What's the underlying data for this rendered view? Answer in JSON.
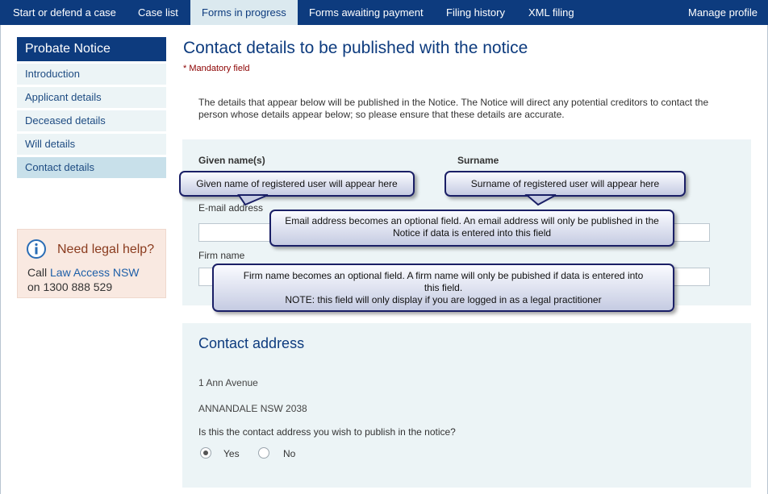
{
  "nav": {
    "items": [
      {
        "label": "Start or defend a case"
      },
      {
        "label": "Case list"
      },
      {
        "label": "Forms in progress",
        "active": true
      },
      {
        "label": "Forms awaiting payment"
      },
      {
        "label": "Filing history"
      },
      {
        "label": "XML filing"
      }
    ],
    "manage_profile": "Manage profile",
    "bar_color": "#0d3b7e"
  },
  "sidebar": {
    "heading": "Probate Notice",
    "items": [
      {
        "label": "Introduction"
      },
      {
        "label": "Applicant details"
      },
      {
        "label": "Deceased details"
      },
      {
        "label": "Will details"
      },
      {
        "label": "Contact details",
        "active": true
      }
    ]
  },
  "help": {
    "icon": "info-icon",
    "title": "Need legal help?",
    "call": "Call",
    "link": "Law Access NSW",
    "phone": "on 1300 888 529"
  },
  "main": {
    "title": "Contact details to be published with the notice",
    "mandatory": "* Mandatory field",
    "intro": "The details that appear below will be published in the Notice. The Notice will direct any potential creditors to contact the person whose details appear below; so please ensure that these details are accurate.",
    "form": {
      "given_name_label": "Given name(s)",
      "surname_label": "Surname",
      "email_label": "E-mail address",
      "email_value": "",
      "firm_label": "Firm name",
      "firm_value": ""
    },
    "contact_address": {
      "heading": "Contact address",
      "line1": "1  Ann Avenue",
      "line2": "ANNANDALE NSW 2038",
      "question": "Is this the contact address you wish to publish in the notice?",
      "options": [
        {
          "label": "Yes",
          "selected": true
        },
        {
          "label": "No",
          "selected": false
        }
      ]
    }
  },
  "callouts": {
    "given_name": "Given name of registered user will appear here",
    "surname": "Surname of registered user will appear here",
    "email": "Email address becomes an optional field. An email address will only be published in the Notice if data is entered into this field",
    "firm": "Firm name becomes an optional field. A firm name will only be pubished if data is entered into this field.",
    "firm_note": "NOTE: this field will only display if you are logged in as a legal practitioner"
  }
}
